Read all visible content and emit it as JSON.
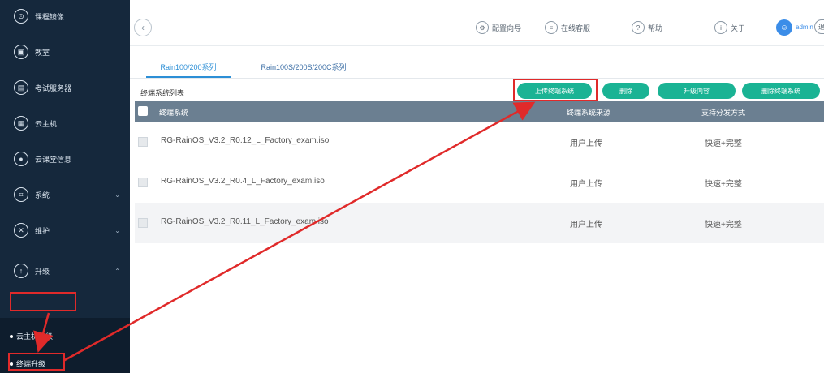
{
  "sidebar": {
    "items": [
      {
        "label": "课程镜像",
        "icon": "camera-icon",
        "glyph": "⊙"
      },
      {
        "label": "教室",
        "icon": "classroom-icon",
        "glyph": "▣"
      },
      {
        "label": "考试服务器",
        "icon": "server-icon",
        "glyph": "▤"
      },
      {
        "label": "云主机",
        "icon": "cloud-host-icon",
        "glyph": "▦"
      },
      {
        "label": "云课堂信息",
        "icon": "info-icon",
        "glyph": "●"
      },
      {
        "label": "系统",
        "icon": "system-icon",
        "glyph": "⌗"
      },
      {
        "label": "维护",
        "icon": "wrench-icon",
        "glyph": "✕"
      },
      {
        "label": "升级",
        "icon": "upgrade-icon",
        "glyph": "↑"
      }
    ],
    "sub_items": [
      {
        "label": "云主机升级"
      },
      {
        "label": "终端升级"
      }
    ]
  },
  "topbar": {
    "back": "‹",
    "buttons": [
      {
        "label": "配置向导",
        "icon": "gear-icon",
        "glyph": "⚙"
      },
      {
        "label": "在线客服",
        "icon": "service-icon",
        "glyph": "≡"
      },
      {
        "label": "帮助",
        "icon": "help-icon",
        "glyph": "?"
      },
      {
        "label": "关于",
        "icon": "about-icon",
        "glyph": "i"
      }
    ],
    "user": "admin",
    "logout": "退"
  },
  "tabs": [
    {
      "label": "Rain100/200系列"
    },
    {
      "label": "Rain100S/200S/200C系列"
    }
  ],
  "list_title": "终端系统列表",
  "actions": [
    {
      "label": "上传终端系统"
    },
    {
      "label": "删除"
    },
    {
      "label": "升级内容"
    },
    {
      "label": "删除终端系统"
    }
  ],
  "table": {
    "headers": [
      "终端系统",
      "终端系统来源",
      "支持分发方式"
    ],
    "rows": [
      {
        "name": "RG-RainOS_V3.2_R0.12_L_Factory_exam.iso",
        "source": "用户上传",
        "mode": "快速+完整"
      },
      {
        "name": "RG-RainOS_V3.2_R0.4_L_Factory_exam.iso",
        "source": "用户上传",
        "mode": "快速+完整"
      },
      {
        "name": "RG-RainOS_V3.2_R0.11_L_Factory_exam.iso",
        "source": "用户上传",
        "mode": "快速+完整"
      }
    ]
  },
  "colors": {
    "sidebar": "#15283c",
    "accent": "#1ab394",
    "highlight": "#e02a2a",
    "header": "#6b7f91"
  }
}
